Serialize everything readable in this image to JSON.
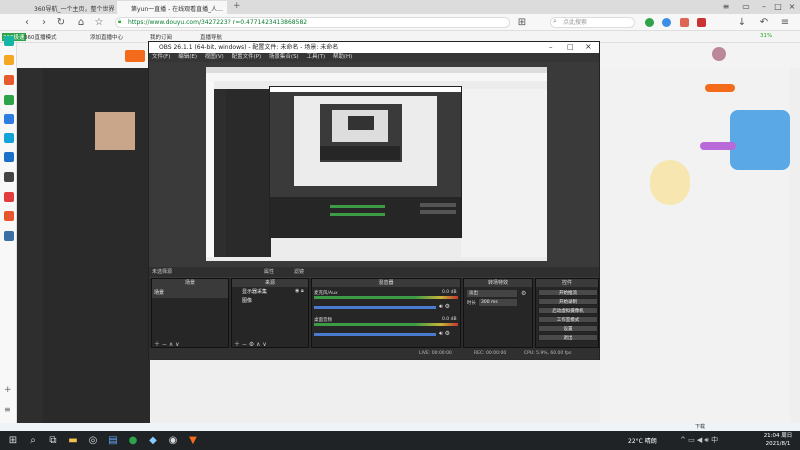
{
  "browser": {
    "tabs": [
      {
        "label": "360导航_一个主页，整个世界",
        "active": false
      },
      {
        "label": "第yun一直播 - 在线观看直播_人...",
        "active": true
      }
    ],
    "url": "https://www.douyu.com/3427223? r=0.4771423413868582",
    "search_placeholder": "点此搜索",
    "bookmarks": [
      "360极速",
      "360直播模式",
      "添加直播中心",
      "我的订阅",
      "直播导航"
    ],
    "battery": "31%"
  },
  "obs": {
    "title": "OBS 26.1.1 (64-bit, windows) - 配置文件: 未命名 - 场景: 未命名",
    "menu": [
      "文件(F)",
      "编辑(E)",
      "视图(V)",
      "配置文件(P)",
      "场景集合(S)",
      "工具(T)",
      "帮助(H)"
    ],
    "no_source": "未选择源",
    "props_btn": "属性",
    "filter_btn": "滤镜",
    "docks": {
      "scenes": {
        "title": "场景",
        "items": [
          "场景"
        ]
      },
      "sources": {
        "title": "来源",
        "items": [
          "显示器采集",
          "图像"
        ]
      },
      "mixer": {
        "title": "混音器",
        "channels": [
          {
            "name": "桌面音频",
            "level": "0.0 dB"
          },
          {
            "name": "麦克风/Aux",
            "level": "0.0 dB"
          }
        ]
      },
      "transitions": {
        "title": "转场特效",
        "type": "淡出",
        "duration_label": "时长",
        "duration": "300 ms"
      },
      "controls": {
        "title": "控件",
        "buttons": [
          "开始推流",
          "开始录制",
          "启动虚拟摄像机",
          "工作室模式",
          "设置",
          "退出"
        ]
      }
    },
    "status": {
      "live": "LIVE: 00:00:00",
      "rec": "REC: 00:00:00",
      "cpu": "CPU: 5.9%, 60.00 fps"
    }
  },
  "downloads": {
    "items": [
      "下载"
    ]
  },
  "taskbar": {
    "weather": "22°C 晴朗",
    "time": "21:04 周日",
    "date": "2021/8/1"
  }
}
